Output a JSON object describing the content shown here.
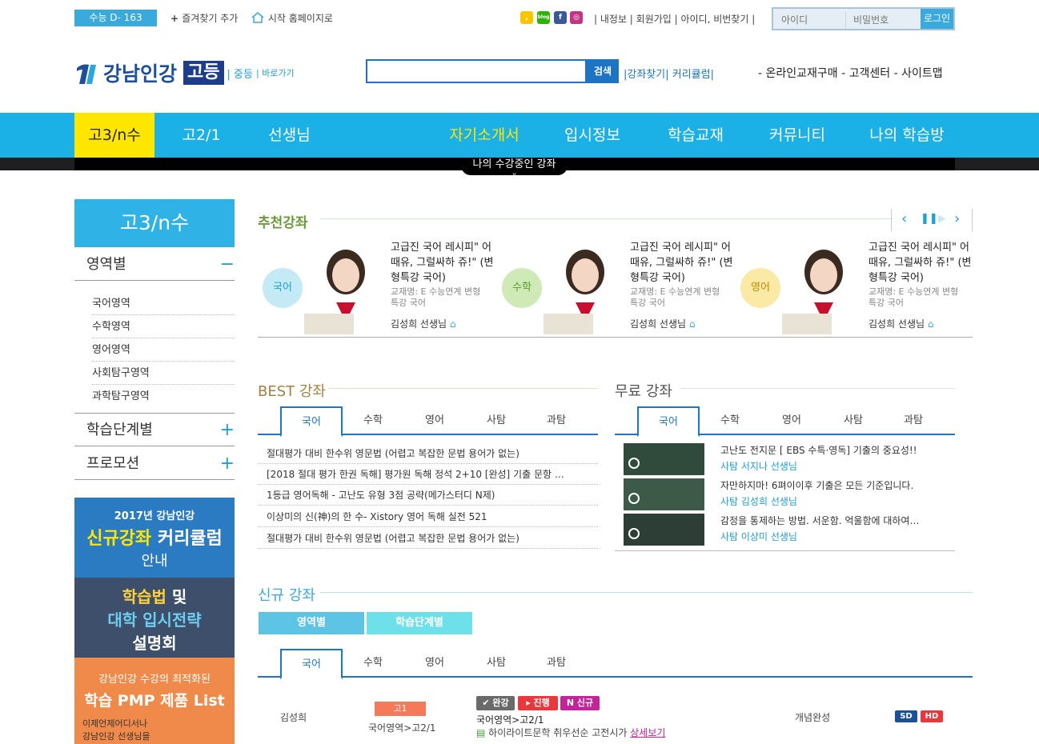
{
  "top": {
    "dday": "수능 D- 163",
    "bookmark": "즐겨찾기 추가",
    "homepage": "시작 홈페이지로",
    "sns": [
      "kakao",
      "blog",
      "facebook",
      "instagram"
    ],
    "util_links": "| 내정보 | 회원가입 | 아이디, 비번찾기 |",
    "id_placeholder": "아이디",
    "pw_placeholder": "비밀번호",
    "login": "로그인"
  },
  "header": {
    "logo_text": "강남인강",
    "logo_badge": "고등",
    "logo_middle": "| 중등",
    "logo_shortcut": "| 바로가기",
    "search_button": "검색",
    "search_links": "|강좌찾기| 커리큘럼|",
    "right_links": "- 온라인교재구매  - 고객센터  - 사이트맵"
  },
  "gnb": {
    "items": [
      "고3/n수",
      "고2/1",
      "선생님",
      "자기소개서",
      "입시정보",
      "학습교재",
      "커뮤니티",
      "나의 학습방"
    ],
    "my_course": "나의 수강중인 강좌"
  },
  "sidebar": {
    "title": "고3/n수",
    "sec1": "영역별",
    "sec1_toggle": "−",
    "subs": [
      "국어영역",
      "수학영역",
      "영어영역",
      "사회탐구영역",
      "과학탐구영역"
    ],
    "sec2": "학습단계별",
    "sec3": "프로모션",
    "plus": "+",
    "banner1": {
      "line1": "2017년 강남인강",
      "line2a": "신규강좌",
      "line2b": " 커리큘럼",
      "line3": "안내"
    },
    "banner2": {
      "line1a": "학습법",
      "line1b": " 및",
      "line2": "대학 입시전략",
      "line3": "설명회"
    },
    "banner3": {
      "line1": "강남인강 수강의 최적화된",
      "line2": "학습 PMP 제품 List",
      "line3": "이제언제어디서나",
      "line4": "강남인강 선생님을"
    }
  },
  "recommend": {
    "title": "추천강좌",
    "items": [
      {
        "subject": "국어",
        "title": "고급진 국어 레시피\" 어때유, 그럴싸하 쥬!\" (변형특강 국어)",
        "book": "교재명: E 수능연계 변형특강 국어",
        "teacher": "김성희 선생님",
        "color": "#c4eaf6"
      },
      {
        "subject": "수학",
        "title": "고급진 국어 레시피\" 어때유, 그럴싸하 쥬!\" (변형특강 국어)",
        "book": "교재명: E 수능연계 변형특강 국어",
        "teacher": "김성희 선생님",
        "color": "#cfeab7"
      },
      {
        "subject": "영어",
        "title": "고급진 국어 레시피\" 어때유, 그럴싸하 쥬!\" (변형특강 국어)",
        "book": "교재명: E 수능연계 변형특강 국어",
        "teacher": "김성희 선생님",
        "color": "#faeaa5"
      }
    ]
  },
  "best": {
    "title": "BEST 강좌",
    "tabs": [
      "국어",
      "수학",
      "영어",
      "사탐",
      "과탐"
    ],
    "rows": [
      "절대평가 대비 한수위 영문법 (어렵고 복잡한 문법 용어가 없는)",
      "[2018 절대 평가 한권 독해] 평가원 독해 정석 2+10 [완성] 기출 문항 …",
      "1등급 영어독해 - 고난도 유형 3점 공략(메가스터디 N제)",
      "이상미의 신(神)의 한 수- Xistory 영어 독해 실전 521",
      "절대평가 대비 한수위 영문법 (어렵고 복잡한 문법 용어가 없는)"
    ]
  },
  "free": {
    "title": "무료 강좌",
    "tabs": [
      "국어",
      "수학",
      "영어",
      "사탐",
      "과탐"
    ],
    "rows": [
      {
        "title": "고난도 전지문 [ EBS 수특·영독] 기출의 중요성!!",
        "teacher": "사탐 서지나 선생님"
      },
      {
        "title": "자만하지마! 6펴이이후 기출은 모든 기준입니다.",
        "teacher": "사탐 김성희 선생님"
      },
      {
        "title": "감정을 통제하는 방법. 서운함. 억울함에 대하여…",
        "teacher": "사탐 이상미 선생님"
      }
    ]
  },
  "newc": {
    "title": "신규 강좌",
    "btn1": "영역별",
    "btn2": "학습단계별",
    "tabs": [
      "국어",
      "수학",
      "영어",
      "사탐",
      "과탐"
    ],
    "row": {
      "teacher": "김성희",
      "grade": "고1",
      "path": "국어영역>고2/1",
      "badges": [
        "완강",
        "진행",
        "신규"
      ],
      "title": "국어영역>고2/1",
      "desc": "하이라이트문학 취우선순 고전시가",
      "detail": "상세보기",
      "level": "개념완성",
      "sd": "SD",
      "hd": "HD"
    }
  }
}
